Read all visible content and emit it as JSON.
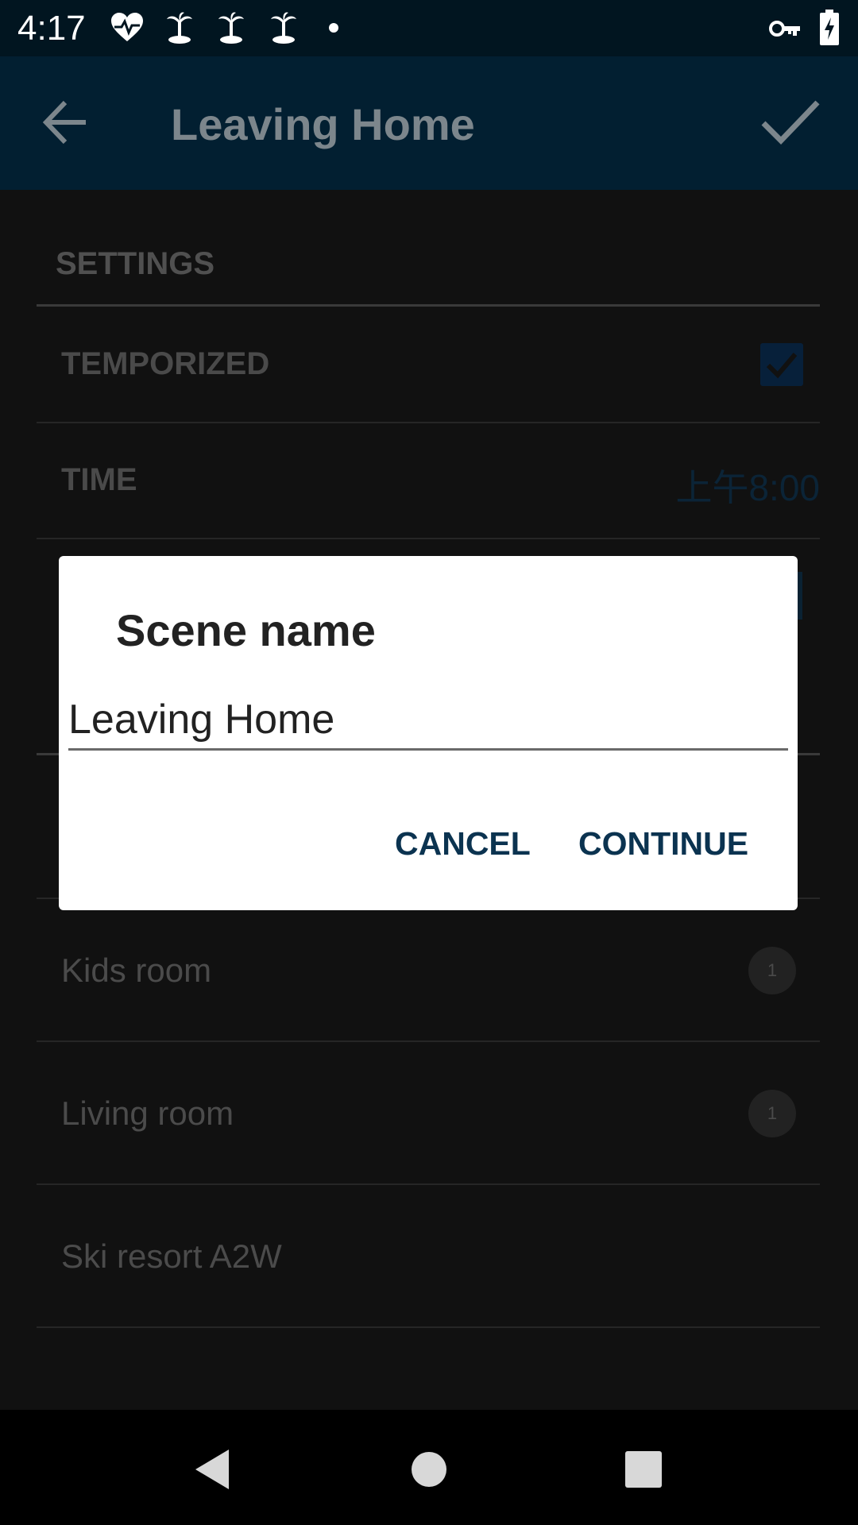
{
  "status_bar": {
    "time": "4:17",
    "icons": [
      "heart-pulse-icon",
      "palm-tree-icon",
      "palm-tree-icon",
      "palm-tree-icon",
      "dot-icon",
      "vpn-key-icon",
      "battery-charging-icon"
    ]
  },
  "app_bar": {
    "title": "Leaving Home",
    "back_icon": "arrow-back-icon",
    "confirm_icon": "check-icon"
  },
  "settings": {
    "section_header": "SETTINGS",
    "temporized_label": "TEMPORIZED",
    "temporized_checked": true,
    "time_label": "TIME",
    "time_value": "上午8:00"
  },
  "rooms": [
    {
      "name": "Kids room",
      "count": "1"
    },
    {
      "name": "Living room",
      "count": "1"
    },
    {
      "name": "Ski resort A2W",
      "count": ""
    }
  ],
  "dialog": {
    "title": "Scene name",
    "input_value": "Leaving Home",
    "cancel_label": "CANCEL",
    "continue_label": "CONTINUE"
  },
  "nav_bar": {
    "back_icon": "nav-back-icon",
    "home_icon": "nav-home-icon",
    "recents_icon": "nav-recents-icon"
  },
  "colors": {
    "status_bar_bg": "#011520",
    "app_bar_bg": "#021f31",
    "accent": "#0b3350",
    "background": "#111111"
  }
}
